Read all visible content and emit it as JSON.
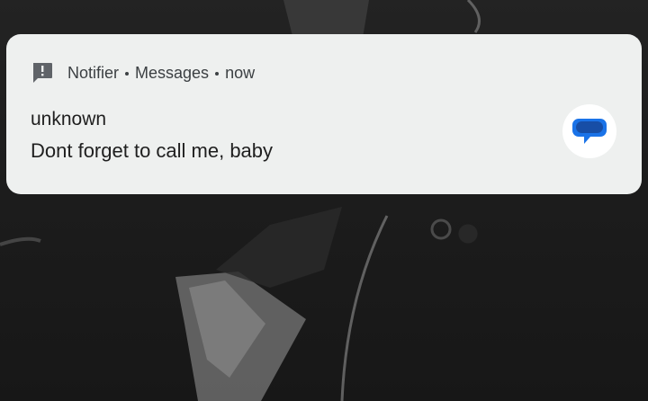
{
  "notification": {
    "app_name": "Notifier",
    "channel": "Messages",
    "time": "now",
    "sender": "unknown",
    "message": "Dont forget to call me, baby",
    "app_icon": "alert-message-icon",
    "large_icon": "messages-chat-bubble-icon"
  },
  "colors": {
    "card_background": "#eef0ef",
    "primary_text": "#1f1f1f",
    "secondary_text": "#3c4043",
    "bubble_blue": "#1a73e8",
    "bubble_dark": "#174ea6"
  }
}
